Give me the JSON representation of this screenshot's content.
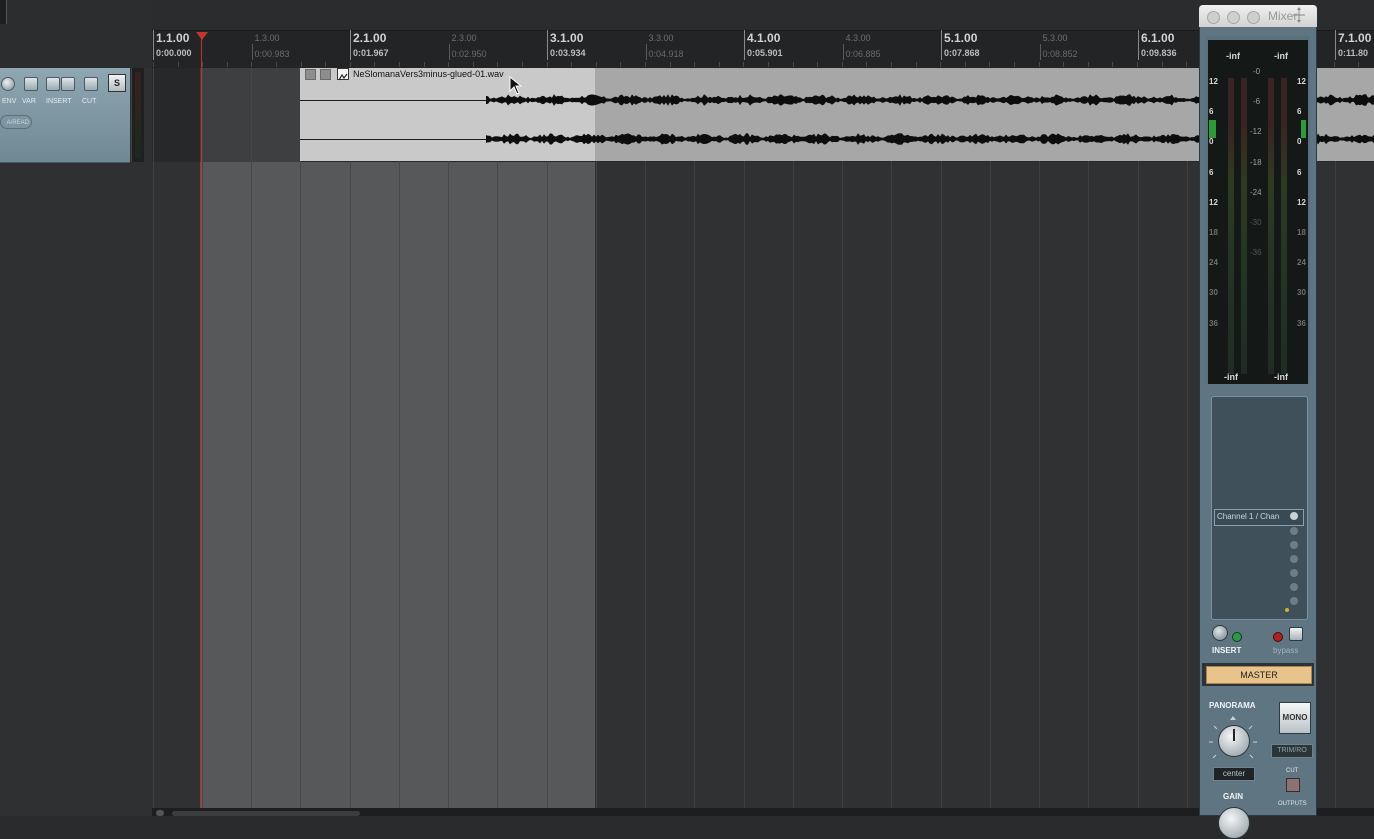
{
  "ruler": {
    "measures": [
      {
        "bar": "1.1.00",
        "time": "0:00.000"
      },
      {
        "bar": "2.1.00",
        "time": "0:01.967"
      },
      {
        "bar": "3.1.00",
        "time": "0:03.934"
      },
      {
        "bar": "4.1.00",
        "time": "0:05.901"
      },
      {
        "bar": "5.1.00",
        "time": "0:07.868"
      },
      {
        "bar": "6.1.00",
        "time": "0:09.836"
      },
      {
        "bar": "7.1.00",
        "time": "0:11.80"
      }
    ],
    "beats": [
      {
        "bar": "1.3.00",
        "time": "0:00.983"
      },
      {
        "bar": "2.3.00",
        "time": "0:02.950"
      },
      {
        "bar": "3.3.00",
        "time": "0:04.918"
      },
      {
        "bar": "4.3.00",
        "time": "0:06.885"
      },
      {
        "bar": "5.3.00",
        "time": "0:08.852"
      }
    ]
  },
  "track_panel": {
    "labels": {
      "env": "ENV",
      "var": "VAR",
      "insert": "INSERT",
      "cut": "CUT"
    },
    "solo": "S",
    "automation_mode": "A/READ"
  },
  "media_item": {
    "filename": "NeSlomanaVers3minus-glued-01.wav"
  },
  "mixer": {
    "title": "Mixer",
    "meter": {
      "peak_left": "-inf",
      "peak_right": "-inf",
      "bottom_left": "-inf",
      "bottom_right": "-inf",
      "scale_side": [
        "12",
        "6",
        "0",
        "6",
        "12",
        "18",
        "24",
        "30",
        "36"
      ],
      "scale_center": [
        "-0",
        "-6",
        "-12",
        "-18",
        "-24",
        "-30",
        "-36"
      ]
    },
    "fx_slot": "Channel 1 / Chan",
    "insert_label": "INSERT",
    "bypass_label": "bypass",
    "channel_name": "MASTER",
    "panorama_label": "PANORAMA",
    "pan_value": "center",
    "mono_label": "MONO",
    "trim_label": "TRIM/RO",
    "cut_label": "CUT",
    "gain_label": "GAIN",
    "outputs_label": "OUTPUTS"
  },
  "colors": {
    "cursor": "#c23434",
    "master_label": "#e8c48c",
    "mixer_body": "#5f7582"
  }
}
